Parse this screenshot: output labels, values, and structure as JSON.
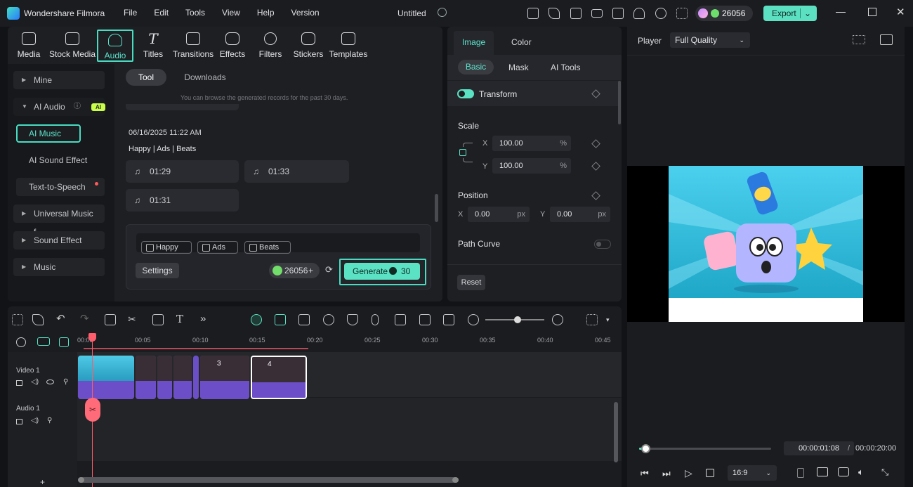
{
  "titlebar": {
    "app_name": "Wondershare Filmora",
    "menu": [
      "File",
      "Edit",
      "Tools",
      "View",
      "Help",
      "Version"
    ],
    "document_title": "Untitled",
    "credits": "26056",
    "export_label": "Export"
  },
  "tooltabs": [
    "Media",
    "Stock Media",
    "Audio",
    "Titles",
    "Transitions",
    "Effects",
    "Filters",
    "Stickers",
    "Templates"
  ],
  "active_tooltab": "Audio",
  "sidebar": {
    "mine": "Mine",
    "ai_audio": "AI Audio",
    "ai_badge": "AI",
    "ai_music": "AI Music",
    "ai_sound_effect": "AI Sound Effect",
    "text_to_speech": "Text-to-Speech",
    "universal_music": "Universal Music f...",
    "sound_effect": "Sound Effect",
    "music": "Music"
  },
  "content": {
    "tab_tool": "Tool",
    "tab_downloads": "Downloads",
    "note": "You can browse the generated records for the past 30 days.",
    "record_date": "06/16/2025 11:22 AM",
    "record_tags": "Happy | Ads | Beats",
    "tracks": [
      "01:29",
      "01:33",
      "01:31"
    ],
    "prompt_tags": [
      "Happy",
      "Ads",
      "Beats"
    ],
    "settings_label": "Settings",
    "credit_balance": "26056",
    "generate_label": "Generate",
    "generate_cost": "30"
  },
  "properties": {
    "tab_image": "Image",
    "tab_color": "Color",
    "subtab_basic": "Basic",
    "subtab_mask": "Mask",
    "subtab_ai_tools": "AI Tools",
    "transform_label": "Transform",
    "scale_label": "Scale",
    "scale_x_label": "X",
    "scale_x": "100.00",
    "scale_y_label": "Y",
    "scale_y": "100.00",
    "percent_unit": "%",
    "position_label": "Position",
    "pos_x_label": "X",
    "pos_x": "0.00",
    "pos_y_label": "Y",
    "pos_y": "0.00",
    "px_unit": "px",
    "path_curve_label": "Path Curve",
    "reset_label": "Reset",
    "transform_enabled": true,
    "path_curve_enabled": false
  },
  "player": {
    "label": "Player",
    "quality": "Full Quality",
    "current_time": "00:00:01:08",
    "separator": "/",
    "total_time": "00:00:20:00",
    "aspect_ratio": "16:9",
    "progress": 0.05
  },
  "timeline": {
    "ruler": [
      "00:00",
      "00:05",
      "00:10",
      "00:15",
      "00:20",
      "00:25",
      "00:30",
      "00:35",
      "00:40",
      "00:45"
    ],
    "video_track": "Video 1",
    "audio_track": "Audio 1",
    "clip_labels": [
      "3",
      "4"
    ],
    "zoom_level": 0.55
  },
  "colors": {
    "accent": "#5be2c4",
    "clip_purple": "#6b4fc6",
    "playhead": "#ff5c6c"
  }
}
